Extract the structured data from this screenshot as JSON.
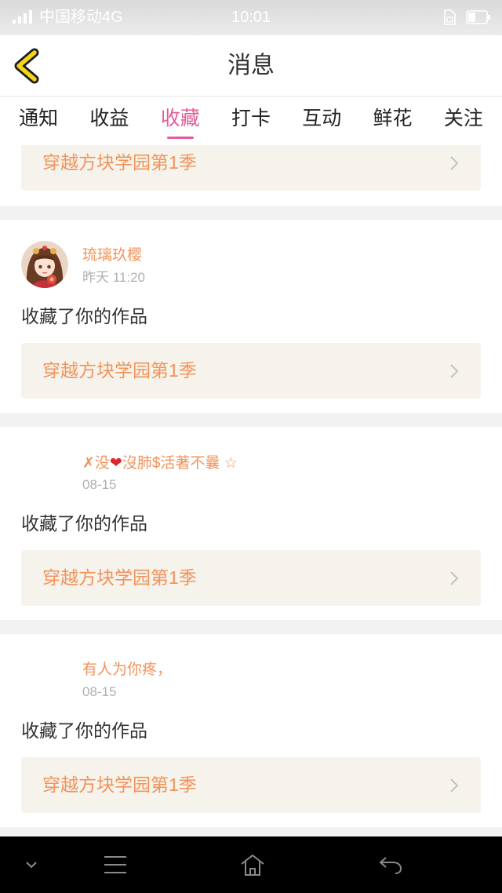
{
  "status_bar": {
    "carrier": "中国移动4G",
    "time": "10:01",
    "battery_level_pct": 40,
    "icons": [
      "signal-icon",
      "sim-card-icon",
      "battery-icon"
    ]
  },
  "header": {
    "title": "消息",
    "back_icon": "chevron-left-icon"
  },
  "tabs": [
    {
      "label": "通知"
    },
    {
      "label": "收益"
    },
    {
      "label": "收藏",
      "active": true
    },
    {
      "label": "打卡"
    },
    {
      "label": "互动"
    },
    {
      "label": "鲜花"
    },
    {
      "label": "关注"
    }
  ],
  "messages": [
    {
      "work_title": "穿越方块学园第1季"
    },
    {
      "user_name": "琉璃玖樱",
      "time": "昨天 11:20",
      "action": "收藏了你的作品",
      "work_title": "穿越方块学园第1季",
      "has_avatar": true
    },
    {
      "user_name": "✗没❤沒肺$活著不曩 ☆",
      "time": "08-15",
      "action": "收藏了你的作品",
      "work_title": "穿越方块学园第1季",
      "has_avatar": false
    },
    {
      "user_name": "有人为你疼，",
      "time": "08-15",
      "action": "收藏了你的作品",
      "work_title": "穿越方块学园第1季",
      "has_avatar": false
    }
  ],
  "nav_bar": {
    "icons": [
      "chevron-down-icon",
      "menu-icon",
      "home-icon",
      "back-arrow-icon"
    ]
  },
  "colors": {
    "accent_pink": "#e45c9b",
    "orange_text": "#f2935b",
    "work_box_bg": "#f5f3eb",
    "page_bg": "#f2f2f2",
    "heart_red": "#e0262c",
    "back_chevron_yellow": "#f4d51c"
  }
}
